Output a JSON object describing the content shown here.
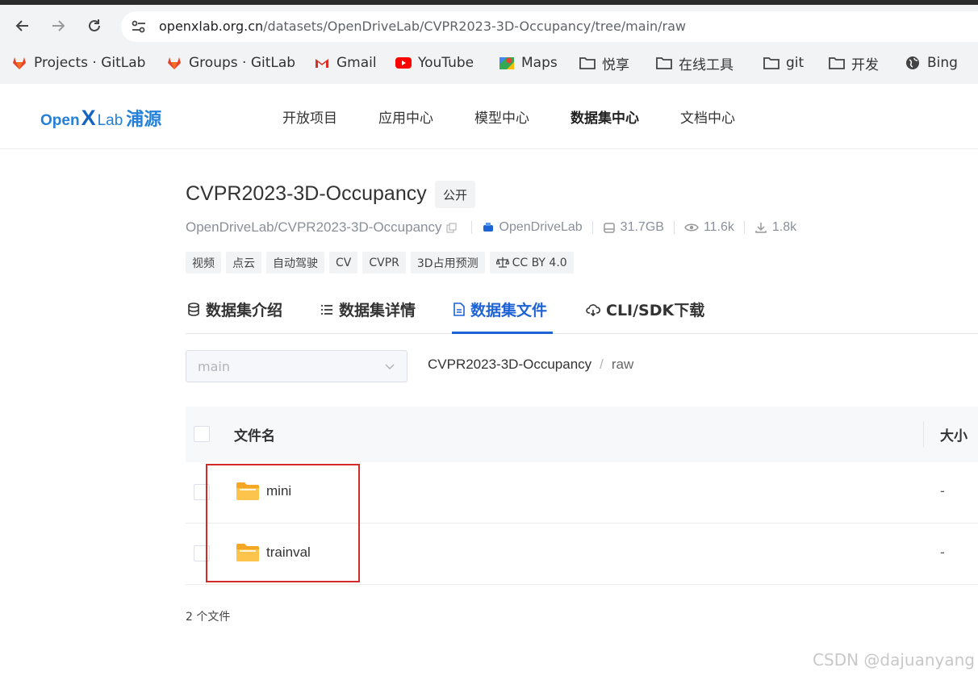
{
  "browser": {
    "url_host": "openxlab.org.cn",
    "url_path": "/datasets/OpenDriveLab/CVPR2023-3D-Occupancy/tree/main/raw",
    "bookmarks": [
      {
        "label": "Projects · GitLab",
        "icon": "gitlab-icon"
      },
      {
        "label": "Groups · GitLab",
        "icon": "gitlab-icon"
      },
      {
        "label": "Gmail",
        "icon": "gmail-icon"
      },
      {
        "label": "YouTube",
        "icon": "youtube-icon"
      },
      {
        "label": "Maps",
        "icon": "maps-icon"
      },
      {
        "label": "悦享",
        "icon": "folder-icon"
      },
      {
        "label": "在线工具",
        "icon": "folder-icon"
      },
      {
        "label": "git",
        "icon": "folder-icon"
      },
      {
        "label": "开发",
        "icon": "folder-icon"
      },
      {
        "label": "Bing",
        "icon": "globe-icon"
      }
    ]
  },
  "site": {
    "logo": {
      "open": "Open",
      "x": "X",
      "lab": "Lab",
      "cn": "浦源"
    },
    "nav": [
      "开放项目",
      "应用中心",
      "模型中心",
      "数据集中心",
      "文档中心"
    ],
    "active_nav": "数据集中心"
  },
  "dataset": {
    "title": "CVPR2023-3D-Occupancy",
    "visibility": "公开",
    "repo": "OpenDriveLab/CVPR2023-3D-Occupancy",
    "owner": "OpenDriveLab",
    "size": "31.7GB",
    "views": "11.6k",
    "downloads": "1.8k",
    "tags": [
      "视频",
      "点云",
      "自动驾驶",
      "CV",
      "CVPR",
      "3D占用预测"
    ],
    "license": "CC BY 4.0"
  },
  "tabs": [
    {
      "label": "数据集介绍",
      "icon": "database-icon"
    },
    {
      "label": "数据集详情",
      "icon": "list-icon"
    },
    {
      "label": "数据集文件",
      "icon": "file-icon"
    },
    {
      "label": "CLI/SDK下载",
      "icon": "cloud-download-icon"
    }
  ],
  "active_tab": "数据集文件",
  "files": {
    "branch": "main",
    "breadcrumb": [
      "CVPR2023-3D-Occupancy",
      "raw"
    ],
    "columns": {
      "name": "文件名",
      "size": "大小"
    },
    "rows": [
      {
        "name": "mini",
        "size": "-"
      },
      {
        "name": "trainval",
        "size": "-"
      }
    ],
    "count_label": "2 个文件"
  },
  "watermark": "CSDN @dajuanyang",
  "colors": {
    "accent": "#1e63d6",
    "highlight": "#d42a2a",
    "folder": "#f7b731"
  }
}
